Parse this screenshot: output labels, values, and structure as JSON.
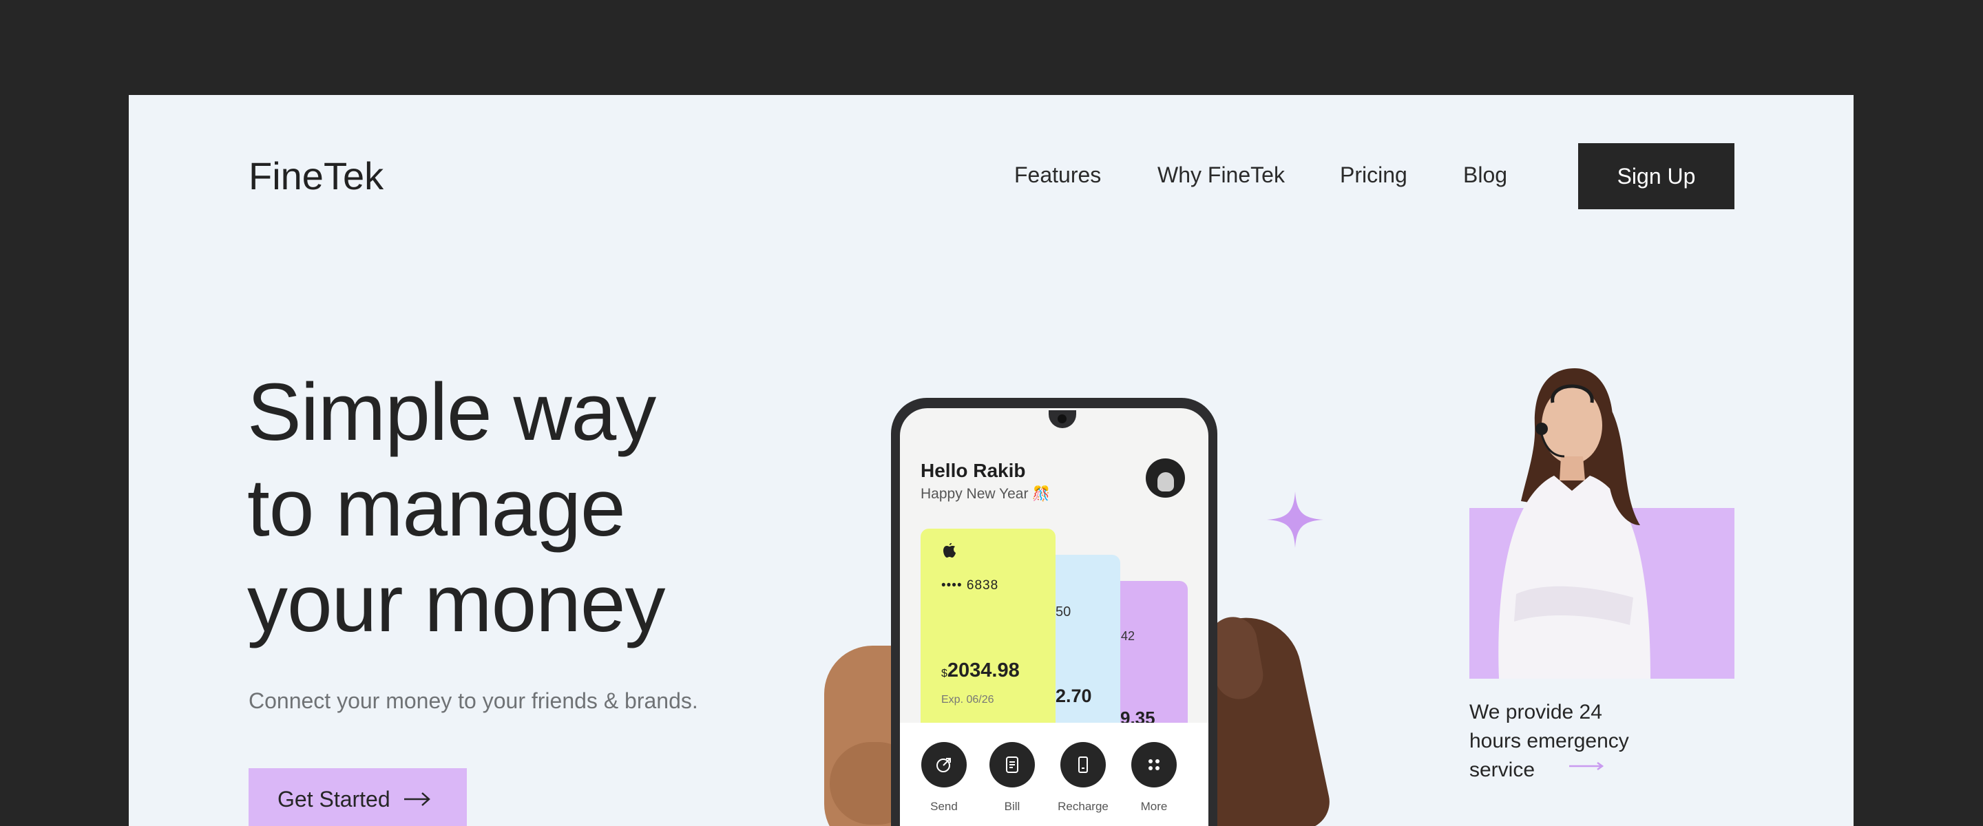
{
  "brand": {
    "logo": "FineTek"
  },
  "nav": {
    "items": [
      "Features",
      "Why FineTek",
      "Pricing",
      "Blog"
    ],
    "signup": "Sign Up"
  },
  "hero": {
    "title_lines": [
      "Simple way",
      "to manage",
      "your money"
    ],
    "subtitle": "Connect your money to your friends & brands.",
    "cta": "Get Started"
  },
  "phone": {
    "greeting": "Hello Rakib",
    "subgreeting": "Happy New Year 🎊",
    "card_primary": {
      "number": "•••• 6838",
      "currency": "$",
      "balance": "2034.98",
      "expiry": "Exp. 06/26"
    },
    "card_secondary": {
      "number_fragment": "50",
      "balance_fragment": "2.70"
    },
    "card_tertiary": {
      "number_fragment": "42",
      "balance_fragment": "9.35"
    },
    "actions": [
      "Send",
      "Bill",
      "Recharge",
      "More"
    ]
  },
  "support": {
    "text_lines": [
      "We provide 24",
      "hours emergency",
      "service"
    ]
  },
  "colors": {
    "page_bg": "#eff4f9",
    "frame": "#262626",
    "accent_purple": "#dab7f7",
    "card_yellow": "#edf97f",
    "card_blue": "#d3ecfa"
  }
}
